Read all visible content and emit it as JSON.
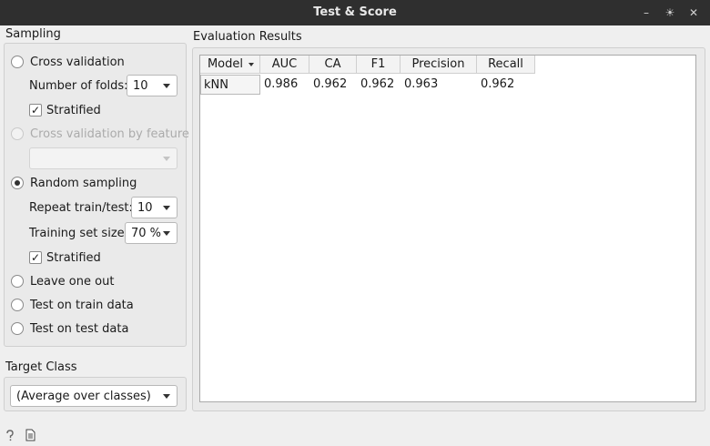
{
  "window": {
    "title": "Test & Score",
    "minimize_glyph": "–",
    "maximize_glyph": "☀",
    "close_glyph": "✕"
  },
  "sampling": {
    "section_label": "Sampling",
    "cross_validation_label": "Cross validation",
    "folds_label": "Number of folds:",
    "folds_value": "10",
    "stratified_1_label": "Stratified",
    "stratified_1_checked": true,
    "cv_by_feature_label": "Cross validation by feature",
    "cv_by_feature_value": "",
    "random_sampling_label": "Random sampling",
    "repeat_label": "Repeat train/test:",
    "repeat_value": "10",
    "training_size_label": "Training set size:",
    "training_size_value": "70 %",
    "stratified_2_label": "Stratified",
    "stratified_2_checked": true,
    "leave_one_out_label": "Leave one out",
    "test_on_train_label": "Test on train data",
    "test_on_test_label": "Test on test data",
    "selected": "random_sampling",
    "check_glyph": "✓"
  },
  "target_class": {
    "section_label": "Target Class",
    "value": "(Average over classes)"
  },
  "results": {
    "section_label": "Evaluation Results",
    "columns": [
      "Model",
      "AUC",
      "CA",
      "F1",
      "Precision",
      "Recall"
    ],
    "rows": [
      {
        "model": "kNN",
        "auc": "0.986",
        "ca": "0.962",
        "f1": "0.962",
        "precision": "0.963",
        "recall": "0.962"
      }
    ]
  },
  "status_bar": {
    "help_icon": "question-mark-icon",
    "report_icon": "document-icon"
  }
}
